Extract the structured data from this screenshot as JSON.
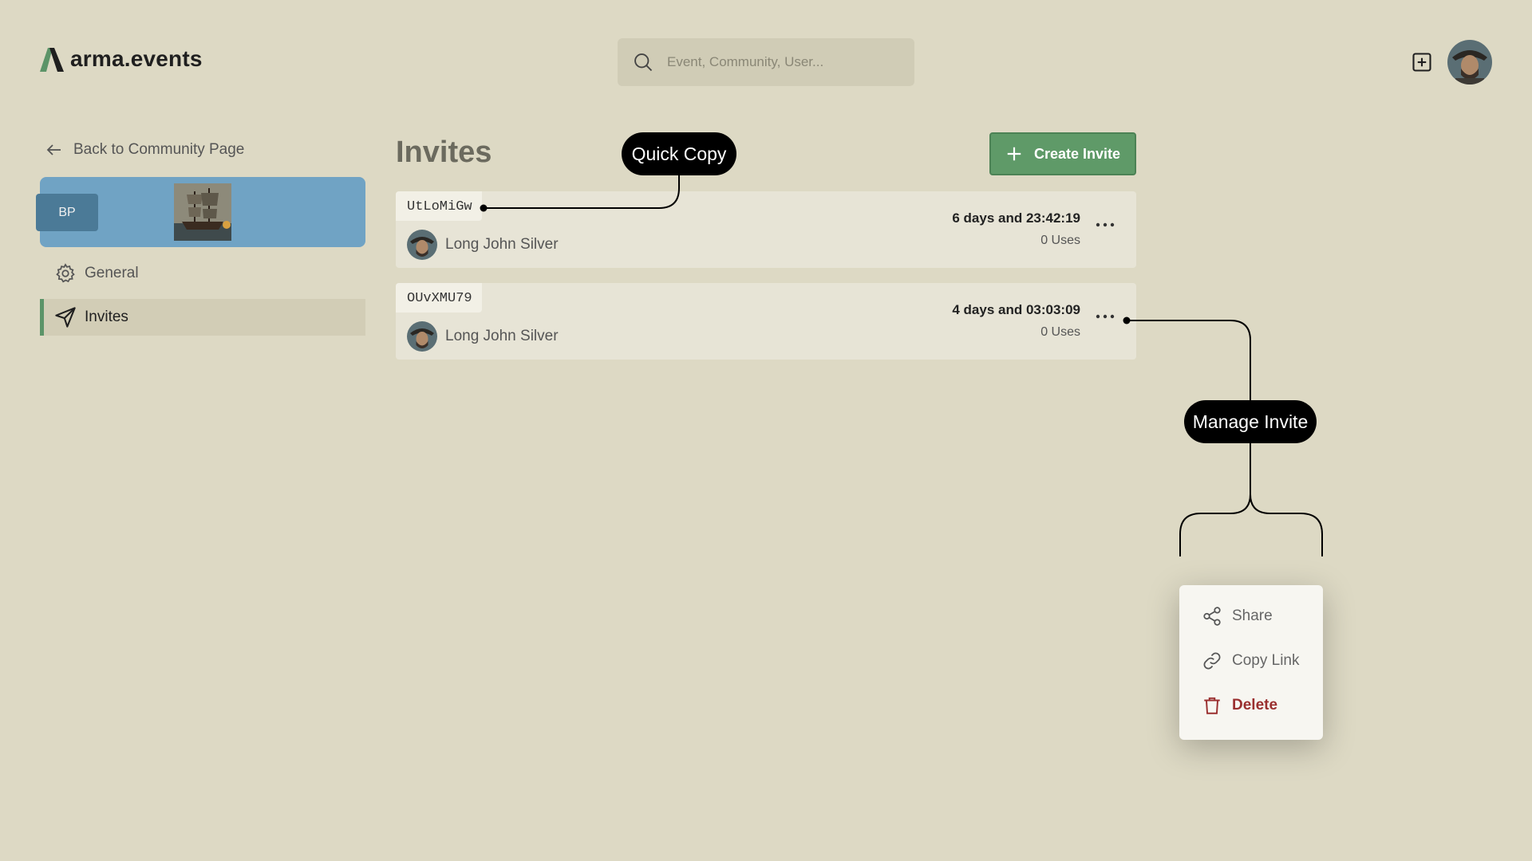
{
  "header": {
    "logo_text": "arma.events",
    "search_placeholder": "Event, Community, User..."
  },
  "sidebar": {
    "back_label": "Back to Community Page",
    "community_initials": "BP",
    "items": [
      {
        "label": "General",
        "icon": "gear-icon",
        "active": false
      },
      {
        "label": "Invites",
        "icon": "send-icon",
        "active": true
      }
    ]
  },
  "main": {
    "title": "Invites",
    "create_label": "Create Invite",
    "invites": [
      {
        "code": "UtLoMiGw",
        "owner": "Long John Silver",
        "expires": "6 days and 23:42:19",
        "uses": "0 Uses"
      },
      {
        "code": "OUvXMU79",
        "owner": "Long John Silver",
        "expires": "4 days and 03:03:09",
        "uses": "0 Uses"
      }
    ]
  },
  "callouts": {
    "quick_copy": "Quick Copy",
    "manage_invite": "Manage Invite"
  },
  "menu": {
    "items": [
      {
        "label": "Share",
        "icon": "share-icon"
      },
      {
        "label": "Copy Link",
        "icon": "link-icon"
      },
      {
        "label": "Delete",
        "icon": "trash-icon"
      }
    ]
  },
  "colors": {
    "background": "#ddd9c4",
    "accent_green": "#5f9a68",
    "community_blue": "#70a3c4",
    "danger": "#9a2f2f"
  }
}
